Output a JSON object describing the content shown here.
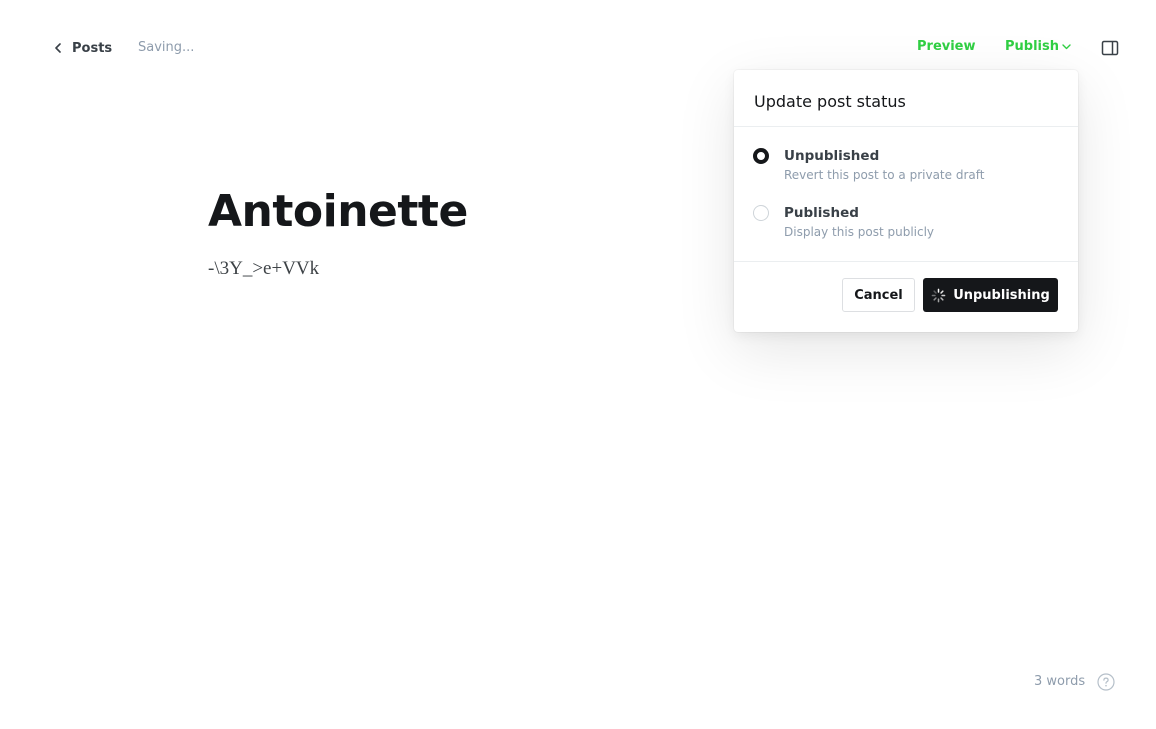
{
  "header": {
    "back_label": "Posts",
    "save_status": "Saving...",
    "preview_label": "Preview",
    "publish_label": "Publish"
  },
  "post": {
    "title": "Antoinette",
    "body": "-\\3Y_>e+VVk"
  },
  "status_popover": {
    "title": "Update post status",
    "options": [
      {
        "label": "Unpublished",
        "description": "Revert this post to a private draft",
        "selected": true
      },
      {
        "label": "Published",
        "description": "Display this post publicly",
        "selected": false
      }
    ],
    "cancel_label": "Cancel",
    "confirm_label": "Unpublishing"
  },
  "footer": {
    "word_count": "3 words"
  },
  "colors": {
    "accent_green": "#30cf43",
    "primary_dark": "#15171a",
    "muted_text": "#8e9cac"
  },
  "icons": {
    "back": "chevron-left-icon",
    "publish_dropdown": "chevron-down-icon",
    "sidebar_toggle": "sidebar-panel-icon",
    "spinner": "loading-spinner-icon",
    "help": "question-circle-icon"
  }
}
